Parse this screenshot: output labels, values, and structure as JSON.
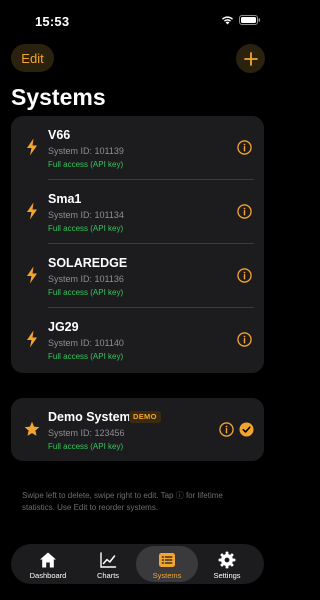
{
  "status_bar": {
    "time": "15:53"
  },
  "header": {
    "edit_label": "Edit",
    "title": "Systems"
  },
  "systems": [
    {
      "name": "V66",
      "system_id": "System ID: 101139",
      "access": "Full access (API key)"
    },
    {
      "name": "Sma1",
      "system_id": "System ID: 101134",
      "access": "Full access (API key)"
    },
    {
      "name": "SOLAREDGE",
      "system_id": "System ID: 101136",
      "access": "Full access (API key)"
    },
    {
      "name": "JG29",
      "system_id": "System ID: 101140",
      "access": "Full access (API key)"
    }
  ],
  "demo": {
    "name": "Demo System",
    "badge": "DEMO",
    "system_id": "System ID: 123456",
    "access": "Full access (API key)"
  },
  "hint": "Swipe left to delete, swipe right to edit. Tap ⓘ for lifetime statistics. Use Edit to reorder systems.",
  "tabs": [
    {
      "label": "Dashboard",
      "icon": "house-icon"
    },
    {
      "label": "Charts",
      "icon": "chart-icon"
    },
    {
      "label": "Systems",
      "icon": "list-icon",
      "active": true
    },
    {
      "label": "Settings",
      "icon": "gear-icon"
    }
  ],
  "colors": {
    "accent": "#f3a531",
    "access_green": "#34c759",
    "card": "#1c1c1e",
    "background": "#000000"
  }
}
